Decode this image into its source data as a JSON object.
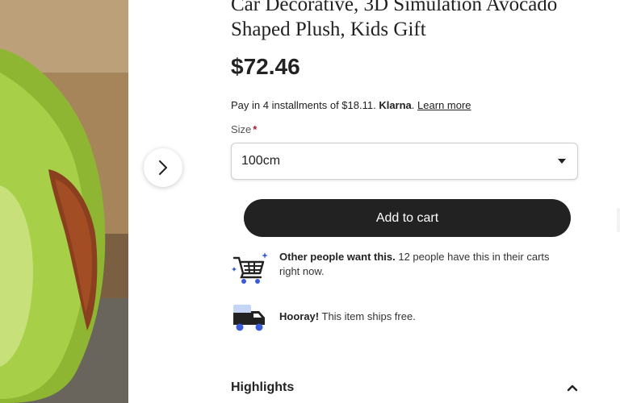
{
  "listing": {
    "title": "Car Decorative, 3D Simulation Avocado Shaped Plush, Kids Gift",
    "price": "$72.46"
  },
  "klarna": {
    "text": "Pay in 4 installments of $18.11.",
    "brand": "Klarna",
    "period": ".",
    "learn_more": "Learn more"
  },
  "size": {
    "label": "Size",
    "required_mark": "*",
    "selected": "100cm"
  },
  "actions": {
    "add_to_cart": "Add to cart"
  },
  "signals": [
    {
      "icon": "cart-icon",
      "bold": "Other people want this.",
      "text": " 12 people have this in their carts right now."
    },
    {
      "icon": "truck-icon",
      "bold": "Hooray!",
      "text": " This item ships free."
    }
  ],
  "highlights": {
    "label": "Highlights",
    "icon": "chevron-up-icon"
  },
  "colors": {
    "button": "#222222",
    "accent_blue": "#3b5bdb",
    "required": "#a61a2e"
  }
}
